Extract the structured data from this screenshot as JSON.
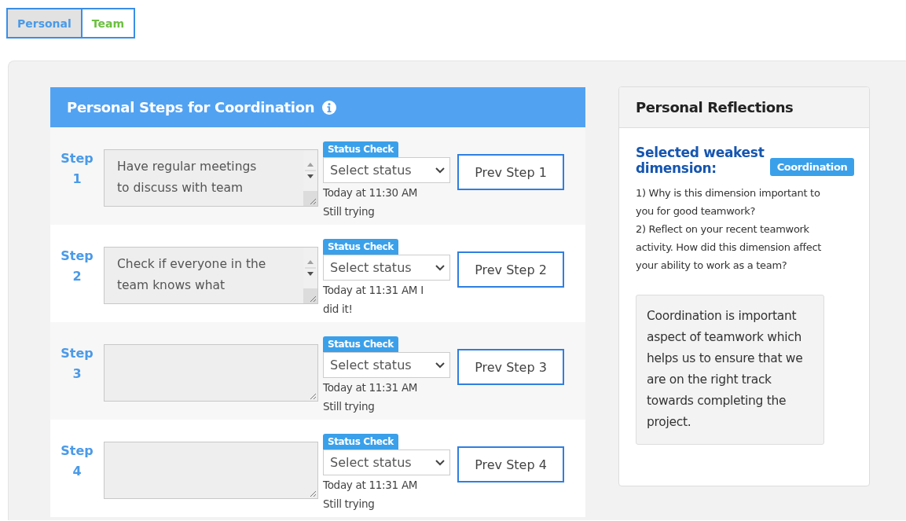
{
  "tabs": [
    {
      "label": "Personal",
      "selected": true
    },
    {
      "label": "Team",
      "selected": false
    }
  ],
  "steps_card": {
    "title": "Personal Steps for Coordination",
    "steps": [
      {
        "label": "Step 1",
        "text": "Have regular meetings to discuss with team",
        "badge": "Status Check",
        "select": "Select status",
        "note": "Today at 11:30 AM Still trying",
        "button": "Prev Step 1"
      },
      {
        "label": "Step 2",
        "text": "Check if everyone in the team knows what",
        "badge": "Status Check",
        "select": "Select status",
        "note": "Today at 11:31 AM I did it!",
        "button": "Prev Step 2"
      },
      {
        "label": "Step 3",
        "badge": "Status Check",
        "select": "Select status",
        "note": "Today at 11:31 AM Still trying",
        "button": "Prev Step 3"
      },
      {
        "label": "Step 4",
        "badge": "Status Check",
        "select": "Select status",
        "note": "Today at 11:31 AM Still trying",
        "button": "Prev Step 4"
      }
    ]
  },
  "reflections": {
    "title": "Personal Reflections",
    "heading": "Selected weakest dimension:",
    "dimension": "Coordination",
    "questions": [
      "1) Why is this dimension important to you for good teamwork?",
      "2) Reflect on your recent teamwork activity. How did this dimension affect your ability to work as a team?"
    ],
    "answer": "Coordination is important aspect of teamwork which helps us to ensure that we are on the right track towards completing the project."
  }
}
